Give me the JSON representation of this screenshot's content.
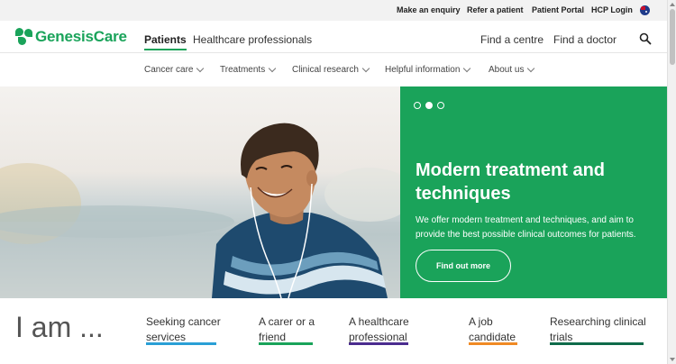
{
  "utility": {
    "links": [
      "Make an enquiry",
      "Refer a patient",
      "Patient Portal",
      "HCP Login"
    ]
  },
  "header": {
    "logo": "GenesisCare",
    "primary": [
      {
        "label": "Patients",
        "active": true
      },
      {
        "label": "Healthcare professionals",
        "active": false
      }
    ],
    "find_centre": "Find a centre",
    "find_doctor": "Find a doctor"
  },
  "subnav": {
    "items": [
      "Cancer care",
      "Treatments",
      "Clinical research",
      "Helpful information",
      "About us"
    ]
  },
  "hero": {
    "slide_count": 3,
    "active_slide": 2,
    "title": "Modern treatment and techniques",
    "description": "We offer modern treatment and techniques, and aim to provide the best possible clinical outcomes for patients.",
    "button": "Find out more",
    "accent_color": "#1aa35a"
  },
  "iam": {
    "title": "I am ...",
    "links": [
      {
        "line1": "Seeking cancer",
        "line2": "services",
        "color": "#2a9fd6"
      },
      {
        "line1": "A carer or a",
        "line2": "friend",
        "color": "#1aa35a"
      },
      {
        "line1": "A healthcare",
        "line2": "professional",
        "color": "#4b2c8f"
      },
      {
        "line1": "A job",
        "line2": "candidate",
        "color": "#f08a24"
      },
      {
        "line1": "Researching clinical",
        "line2": "trials",
        "color": "#0f6b4a"
      }
    ]
  }
}
